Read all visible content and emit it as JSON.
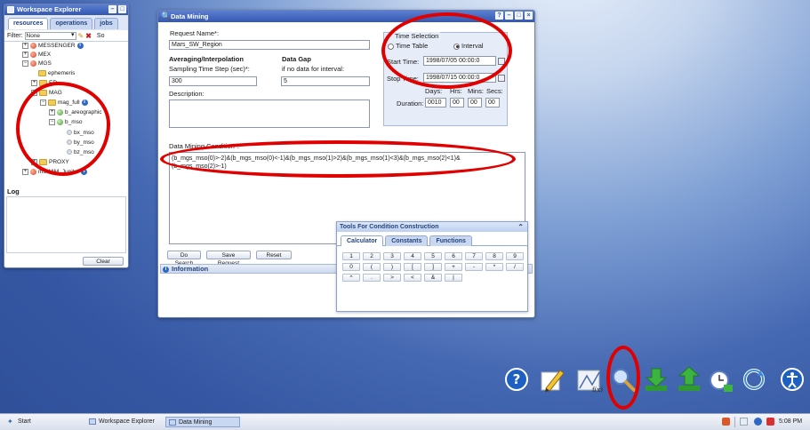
{
  "workspace_explorer": {
    "title": "Workspace Explorer",
    "tabs": [
      "resources",
      "operations",
      "jobs"
    ],
    "filter_label": "Filter:",
    "filter_value": "None",
    "sort_label": "So",
    "tree": {
      "messenger": "MESSENGER",
      "mex": "MEX",
      "mgs": "MGS",
      "ephemeris": "ephemeris",
      "er": "ER",
      "mag": "MAG",
      "mag_full": "mag_full",
      "b_areographic": "b_areographic",
      "b_mso": "b_mso",
      "bx_mso": "bx_mso",
      "by_mso": "by_mso",
      "bz_mso": "bz_mso",
      "proxy": "PROXY",
      "mswim_jupiter": "mSWIM_Jupiter"
    },
    "log_label": "Log",
    "clear_button": "Clear"
  },
  "data_mining": {
    "title": "Data Mining",
    "request_name_label": "Request Name*:",
    "request_name_value": "Mars_SW_Region",
    "averaging_label": "Averaging/Interpolation",
    "sampling_label": "Sampling Time Step (sec)*:",
    "sampling_value": "300",
    "data_gap_label": "Data Gap",
    "data_gap_sub": "if no data for interval:",
    "data_gap_value": "5",
    "description_label": "Description:",
    "time_selection_label": "Time Selection",
    "time_table_label": "Time Table",
    "interval_label": "Interval",
    "start_time_label": "Start Time:",
    "start_time_value": "1998/07/05 00:00:0",
    "stop_time_label": "Stop Time:",
    "stop_time_value": "1998/07/15 00:00:0",
    "duration_headers": [
      "Days:",
      "Hrs:",
      "Mins:",
      "Secs:"
    ],
    "duration_label": "Duration:",
    "duration_values": [
      "0010",
      "00",
      "00",
      "00"
    ],
    "condition_label": "Data Mining Condition*:",
    "condition_line1": "(b_mgs_mso(0)>-2)&(b_mgs_mso(0)<-1)&(b_mgs_mso(1)>2)&(b_mgs_mso(1)<3)&(b_mgs_mso(2)<1)&",
    "condition_line2": "(b_mgs_mso(2)>-1)",
    "buttons": [
      "Do Search",
      "Save Request",
      "Reset"
    ],
    "information_label": "Information"
  },
  "tools": {
    "title": "Tools For Condition Construction",
    "tabs": [
      "Calculator",
      "Constants",
      "Functions"
    ],
    "keys": [
      "1",
      "2",
      "3",
      "4",
      "5",
      "6",
      "7",
      "8",
      "9",
      "0",
      "(",
      ")",
      "[",
      "]",
      "+",
      "-",
      "*",
      "/",
      "^",
      ".",
      ">",
      "<",
      "&",
      "|"
    ]
  },
  "desktop_icons": [
    "help-icon",
    "pencil-icon",
    "function-icon",
    "search-icon",
    "download-icon",
    "upload-icon",
    "clock-icon",
    "refresh-icon",
    "accessibility-icon"
  ],
  "function_icon_text": "f(x)=",
  "taskbar": {
    "start": "Start",
    "items": [
      "Workspace Explorer",
      "Data Mining"
    ],
    "clock": "5:08 PM"
  },
  "colors": {
    "annotation": "#e00000",
    "titlebar": "#3457b2"
  }
}
